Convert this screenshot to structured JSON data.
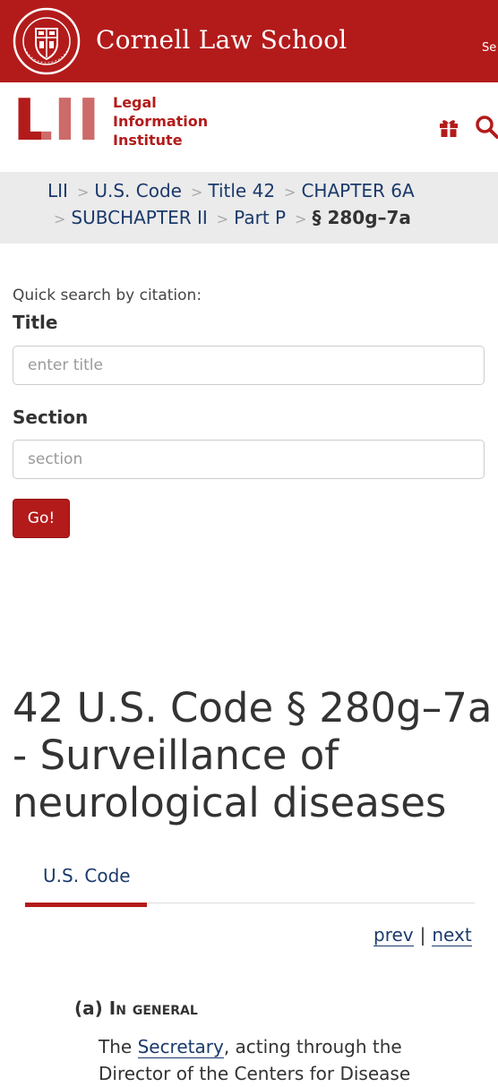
{
  "header": {
    "site_name": "Cornell Law School",
    "search_label": "Se"
  },
  "lii": {
    "logo_letters": "LII",
    "name_line1": "Legal",
    "name_line2": "Information",
    "name_line3": "Institute"
  },
  "breadcrumb": {
    "items": [
      "LII",
      "U.S. Code",
      "Title 42",
      "CHAPTER 6A",
      "SUBCHAPTER II",
      "Part P"
    ],
    "separator": ">",
    "current": "§ 280g–7a"
  },
  "search_form": {
    "intro": "Quick search by citation:",
    "title_label": "Title",
    "title_placeholder": "enter title",
    "section_label": "Section",
    "section_placeholder": "section",
    "go_label": "Go!"
  },
  "page": {
    "title": "42 U.S. Code § 280g–7a - Surveillance of neurological diseases",
    "tab_label": "U.S. Code",
    "prev_label": "prev",
    "pager_separator": "|",
    "next_label": "next"
  },
  "section": {
    "marker": "(a)",
    "heading": "In general",
    "text_before": "The",
    "link": "Secretary",
    "text_after": ", acting through the Director of the Centers for Disease"
  },
  "colors": {
    "brand_red": "#b31b1b",
    "link_blue": "#1b3a6b",
    "breadcrumb_bg": "#ebebeb"
  }
}
